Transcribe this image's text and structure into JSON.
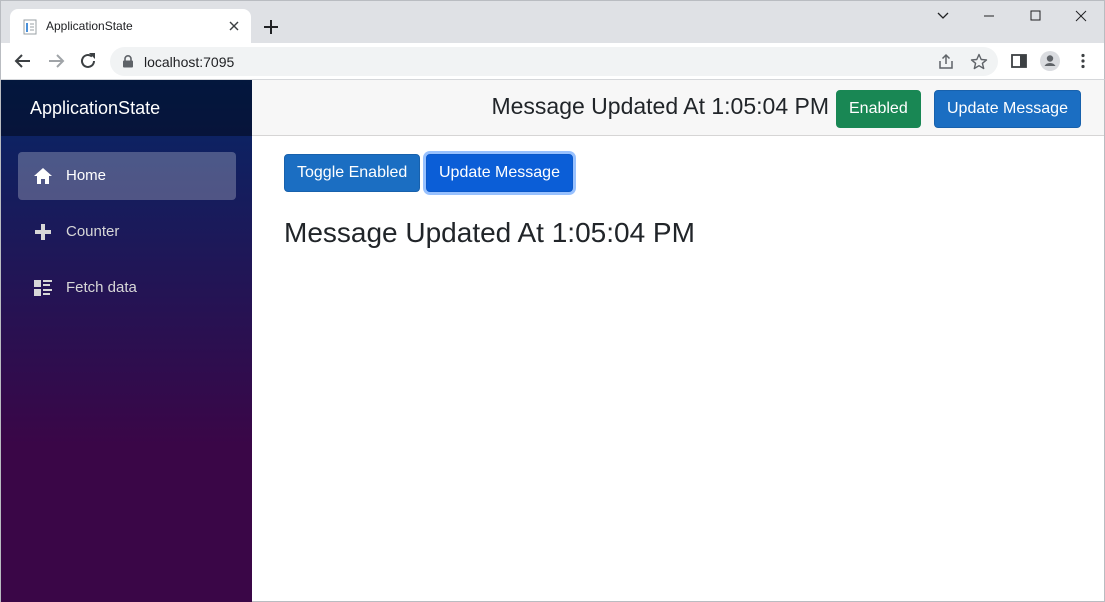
{
  "browser": {
    "tab_title": "ApplicationState",
    "url": "localhost:7095"
  },
  "app": {
    "brand": "ApplicationState",
    "nav": [
      {
        "label": "Home",
        "icon": "home-icon",
        "active": true
      },
      {
        "label": "Counter",
        "icon": "plus-icon",
        "active": false
      },
      {
        "label": "Fetch data",
        "icon": "list-rich-icon",
        "active": false
      }
    ],
    "topbar": {
      "message": "Message Updated At 1:05:04 PM",
      "enabled_label": "Enabled",
      "update_label": "Update Message"
    },
    "main": {
      "toggle_label": "Toggle Enabled",
      "update_label": "Update Message",
      "message": "Message Updated At 1:05:04 PM"
    }
  },
  "colors": {
    "success": "#198754",
    "primary": "#1b6ec2",
    "sidebar_top": "#052767",
    "sidebar_bottom": "#3a0647"
  }
}
